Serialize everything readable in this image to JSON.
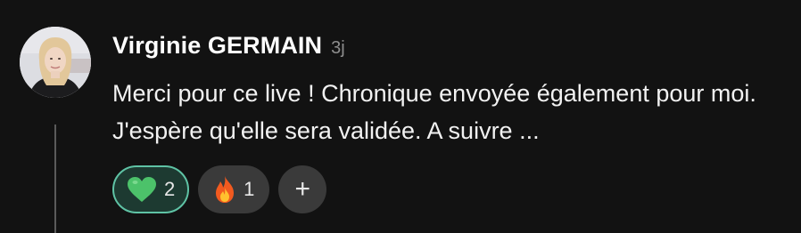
{
  "comment": {
    "author": "Virginie GERMAIN",
    "time": "3j",
    "text": "Merci pour ce live ! Chronique envoyée également pour moi. J'espère qu'elle sera validée. A suivre ...",
    "avatar_icon": "user-photo-avatar",
    "reactions": [
      {
        "emoji": "green-heart-icon",
        "count": "2",
        "selected": true,
        "accent": "#5fc3a5"
      },
      {
        "emoji": "fire-icon",
        "count": "1",
        "selected": false
      }
    ],
    "add_reaction_label": "+"
  },
  "colors": {
    "background": "#121212",
    "pill": "#3a3a3a",
    "selected_pill": "#1d3a31",
    "selected_border": "#5fc3a5",
    "heart": "#4cc26a",
    "thread_line": "#5a5a5a"
  }
}
